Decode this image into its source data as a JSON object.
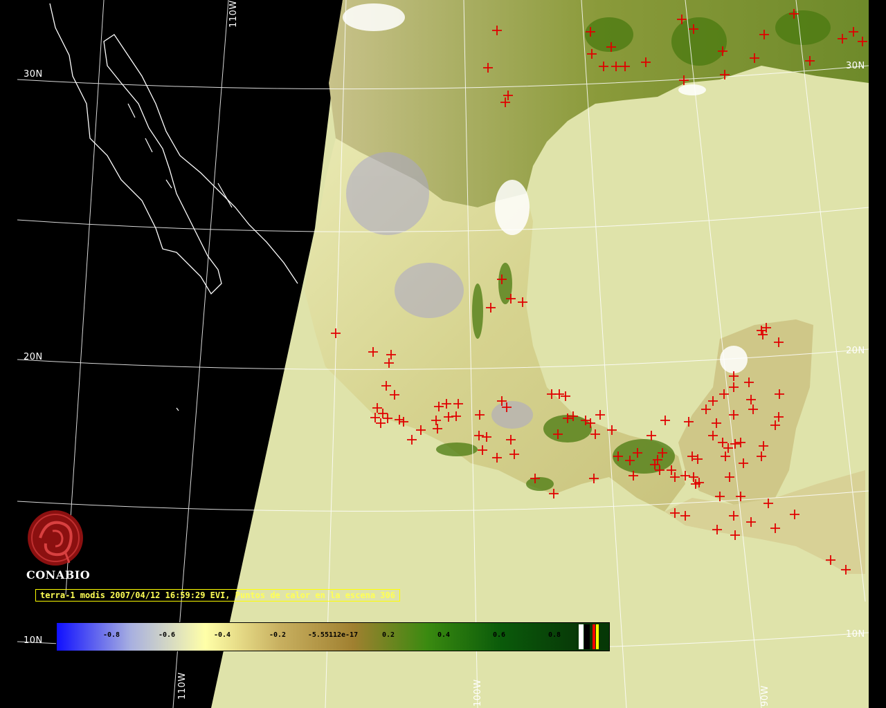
{
  "map": {
    "grid_labels": {
      "lat_30n_left": "30N",
      "lat_20n_left": "20N",
      "lat_10n_left": "10N",
      "lat_30n_right": "30N",
      "lat_20n_right": "20N",
      "lat_10n_right": "10N",
      "lon_110w_top": "110W",
      "lon_110w_bottom": "110W",
      "lon_100w_bottom": "100W",
      "lon_90w_bottom": "90W"
    },
    "colors": {
      "background": "#000000",
      "coastline": "#ffffff",
      "graticule": "#ffffff",
      "fire_marker": "#e00000",
      "ocean": "#dfe3aa"
    },
    "fire_marker_icon": "red-cross-icon"
  },
  "branding": {
    "logo_text": "CONABIO",
    "logo_icon": "conabio-emblem-icon"
  },
  "caption": {
    "text": "terra-1 modis 2007/04/12 16:59:29 EVI, Puntos de calor en la escena 306"
  },
  "colorbar": {
    "ticks": [
      {
        "label": "-0.8",
        "value": -0.8
      },
      {
        "label": "-0.6",
        "value": -0.6
      },
      {
        "label": "-0.4",
        "value": -0.4
      },
      {
        "label": "-0.2",
        "value": -0.2
      },
      {
        "label": "-5.55112e-17",
        "value": 0.0
      },
      {
        "label": "0.2",
        "value": 0.2
      },
      {
        "label": "0.4",
        "value": 0.4
      },
      {
        "label": "0.6",
        "value": 0.6
      },
      {
        "label": "0.8",
        "value": 0.8
      }
    ],
    "stops": [
      "#1010ff",
      "#a8b0e0",
      "#ffffa8",
      "#c8b060",
      "#a08030",
      "#3a8a10",
      "#0a5a0a",
      "#083a08"
    ],
    "end_swatches": [
      "#ffffff",
      "#000000",
      "#ff0000",
      "#ffff00"
    ]
  }
}
